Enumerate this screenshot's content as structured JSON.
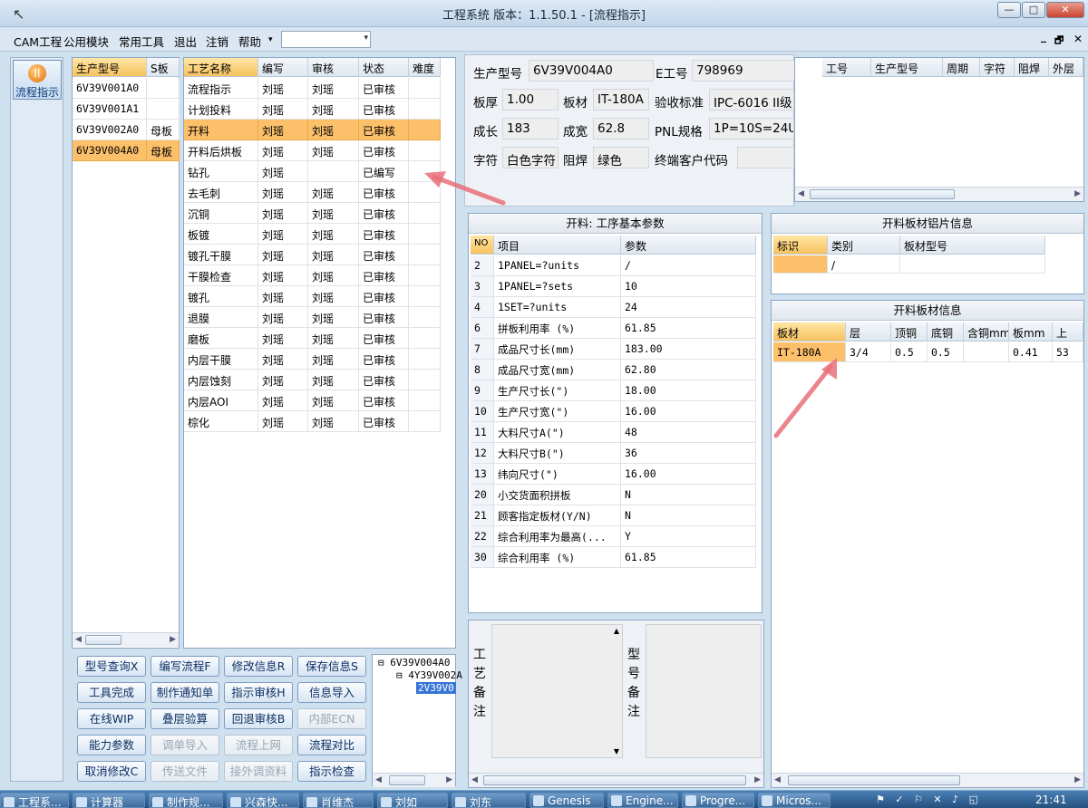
{
  "window": {
    "title": "工程系统    版本：1.1.50.1 - [流程指示]",
    "btn_min": "—",
    "btn_max": "□",
    "btn_close": "✕"
  },
  "menu": {
    "items": [
      "CAM工程",
      "公用模块",
      "常用工具",
      "退出",
      "注销",
      "帮助"
    ],
    "combo_value": "",
    "mdi_min": "_",
    "mdi_restore": "🗗",
    "mdi_close": "✕"
  },
  "nav": {
    "button_label": "流程指示",
    "icon": "circle-orange-icon"
  },
  "models": {
    "headers": [
      "生产型号",
      "S板"
    ],
    "rows": [
      [
        "6V39V001A0",
        ""
      ],
      [
        "6V39V001A1",
        ""
      ],
      [
        "6V39V002A0",
        "母板"
      ],
      [
        "6V39V004A0",
        "母板"
      ]
    ],
    "selected": 3
  },
  "process": {
    "headers": [
      "工艺名称",
      "编写",
      "审核",
      "状态",
      "难度"
    ],
    "rows": [
      [
        "流程指示",
        "刘瑶",
        "刘瑶",
        "已审核",
        ""
      ],
      [
        "计划投料",
        "刘瑶",
        "刘瑶",
        "已审核",
        ""
      ],
      [
        "开料",
        "刘瑶",
        "刘瑶",
        "已审核",
        ""
      ],
      [
        "开料后烘板",
        "刘瑶",
        "刘瑶",
        "已审核",
        ""
      ],
      [
        "钻孔",
        "刘瑶",
        "",
        "已编写",
        ""
      ],
      [
        "去毛刺",
        "刘瑶",
        "刘瑶",
        "已审核",
        ""
      ],
      [
        "沉铜",
        "刘瑶",
        "刘瑶",
        "已审核",
        ""
      ],
      [
        "板镀",
        "刘瑶",
        "刘瑶",
        "已审核",
        ""
      ],
      [
        "镀孔干膜",
        "刘瑶",
        "刘瑶",
        "已审核",
        ""
      ],
      [
        "干膜检查",
        "刘瑶",
        "刘瑶",
        "已审核",
        ""
      ],
      [
        "镀孔",
        "刘瑶",
        "刘瑶",
        "已审核",
        ""
      ],
      [
        "退膜",
        "刘瑶",
        "刘瑶",
        "已审核",
        ""
      ],
      [
        "磨板",
        "刘瑶",
        "刘瑶",
        "已审核",
        ""
      ],
      [
        "内层干膜",
        "刘瑶",
        "刘瑶",
        "已审核",
        ""
      ],
      [
        "内层蚀刻",
        "刘瑶",
        "刘瑶",
        "已审核",
        ""
      ],
      [
        "内层AOI",
        "刘瑶",
        "刘瑶",
        "已审核",
        ""
      ],
      [
        "棕化",
        "刘瑶",
        "刘瑶",
        "已审核",
        ""
      ]
    ],
    "selected": 2
  },
  "buttons": [
    [
      "型号查询X",
      "编写流程F",
      "修改信息R",
      "保存信息S"
    ],
    [
      "工具完成",
      "制作通知单",
      "指示审核H",
      "信息导入"
    ],
    [
      "在线WIP",
      "叠层验算",
      "回退审核B",
      "内部ECN"
    ],
    [
      "能力参数",
      "调单导入",
      "流程上网",
      "流程对比"
    ],
    [
      "取消修改C",
      "传送文件",
      "接外调资料",
      "指示检查"
    ]
  ],
  "buttons_disabled": [
    [
      false,
      false,
      false,
      false
    ],
    [
      false,
      false,
      false,
      false
    ],
    [
      false,
      false,
      false,
      true
    ],
    [
      false,
      true,
      true,
      false
    ],
    [
      false,
      true,
      true,
      false
    ]
  ],
  "tree": {
    "nodes": [
      "6V39V004A0",
      "4Y39V002A",
      "2V39V0"
    ]
  },
  "info": {
    "prod_label": "生产型号",
    "prod_value": "6V39V004A0",
    "e_label": "E工号",
    "e_value": "798969",
    "thick_label": "板厚",
    "thick_value": "1.00",
    "mat_label": "板材",
    "mat_value": "IT-180A",
    "std_label": "验收标准",
    "std_value": "IPC-6016 II级",
    "len_label": "成长",
    "len_value": "183",
    "wid_label": "成宽",
    "wid_value": "62.8",
    "pnl_label": "PNL规格",
    "pnl_value": "1P=10S=24U",
    "char_label": "字符",
    "char_value": "白色字符",
    "mask_label": "阻焊",
    "mask_value": "绿色",
    "cust_label": "终端客户代码",
    "cust_value": ""
  },
  "orders": {
    "headers": [
      "工号",
      "生产型号",
      "周期",
      "字符",
      "阻焊",
      "外层"
    ]
  },
  "params": {
    "title": "开料: 工序基本参数",
    "headers": [
      "NO",
      "项目",
      "参数"
    ],
    "rows": [
      [
        "2",
        "1PANEL=?units",
        "/"
      ],
      [
        "3",
        "1PANEL=?sets",
        "10"
      ],
      [
        "4",
        "1SET=?units",
        "24"
      ],
      [
        "6",
        "拼板利用率 (%)",
        "61.85"
      ],
      [
        "7",
        "成品尺寸长(mm)",
        "183.00"
      ],
      [
        "8",
        "成品尺寸宽(mm)",
        "62.80"
      ],
      [
        "9",
        "生产尺寸长(\")",
        "18.00"
      ],
      [
        "10",
        "生产尺寸宽(\")",
        "16.00"
      ],
      [
        "11",
        "大料尺寸A(\")",
        "48"
      ],
      [
        "12",
        "大料尺寸B(\")",
        "36"
      ],
      [
        "13",
        "纬向尺寸(\")",
        "16.00"
      ],
      [
        "20",
        "小交货面积拼板",
        "N"
      ],
      [
        "21",
        "顾客指定板材(Y/N)",
        "N"
      ],
      [
        "22",
        "综合利用率为最高(...",
        "Y"
      ],
      [
        "30",
        "综合利用率 (%)",
        "61.85"
      ]
    ]
  },
  "alu": {
    "title": "开料板材铝片信息",
    "headers": [
      "标识",
      "类别",
      "板材型号"
    ],
    "row": [
      "",
      "/",
      ""
    ]
  },
  "board": {
    "title": "开料板材信息",
    "headers": [
      "板材",
      "层",
      "顶铜",
      "底铜",
      "含铜mm",
      "板mm",
      "上"
    ],
    "row": [
      "IT-180A",
      "3/4",
      "0.5",
      "0.5",
      "",
      "0.41",
      "53"
    ]
  },
  "notes": {
    "process_label": [
      "工",
      "艺",
      "备",
      "注"
    ],
    "model_label": [
      "型",
      "号",
      "备",
      "注"
    ]
  },
  "taskbar": {
    "items": [
      "工程系...",
      "计算器",
      "制作规...",
      "兴森快...",
      "肖维杰",
      "刘如",
      "刘东",
      "Genesis",
      "Engine...",
      "Progre...",
      "Micros..."
    ],
    "clock": "21:41"
  },
  "colors": {
    "selection": "#fcc06a",
    "header_selected": "#f7c25e",
    "annotation_arrow": "#e8707a"
  }
}
